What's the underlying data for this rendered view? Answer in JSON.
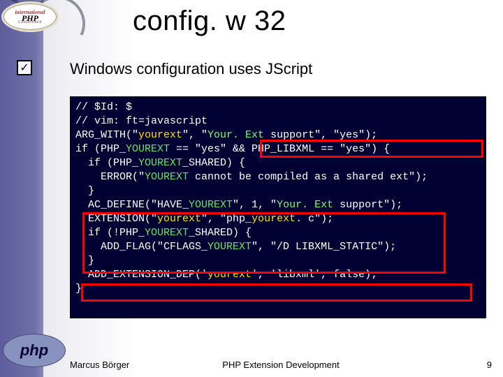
{
  "badge": {
    "line1": "international",
    "line2": "PHP",
    "line3": "conference"
  },
  "title": "config. w 32",
  "subtitle": "Windows configuration uses JScript",
  "checkmark": "✓",
  "code": {
    "l01": "// $Id: $",
    "l02": "// vim: ft=javascript",
    "l03a": "ARG_WITH(\"",
    "l03b": "yourext",
    "l03c": "\", \"",
    "l03d": "Your. Ext",
    "l03e": " support\", \"yes\");",
    "l04a": "if (PHP_",
    "l04b": "YOUREXT",
    "l04c": " == \"yes\"",
    "l04d": " && PHP_LIBXML == \"yes\")",
    "l04e": " {",
    "l05a": "  if (PHP_",
    "l05b": "YOUREXT",
    "l05c": "_SHARED) {",
    "l06a": "    ERROR(\"",
    "l06b": "YOUREXT",
    "l06c": " cannot be compiled as a shared ext\");",
    "l07": "  }",
    "l08a": "  AC_DEFINE(\"HAVE_",
    "l08b": "YOUREXT",
    "l08c": "\", 1, \"",
    "l08d": "Your. Ext",
    "l08e": " support\");",
    "l09a": "  EXTENSION(\"",
    "l09b": "yourext",
    "l09c": "\", \"php_",
    "l09d": "yourext",
    "l09e": ". c\");",
    "l10a": "  if (!PHP_",
    "l10b": "YOUREXT",
    "l10c": "_SHARED) {",
    "l11a": "    ADD_FLAG(\"CFLAGS_",
    "l11b": "YOUREXT",
    "l11c": "\", \"/D LIBXML_STATIC\");",
    "l12": "  }",
    "l13a": "  ADD_EXTENSION_DEP('",
    "l13b": "yourext",
    "l13c": "', 'libxml', false);",
    "l14": "}"
  },
  "footer": {
    "author": "Marcus Börger",
    "title": "PHP Extension Development",
    "page": "9"
  },
  "phplogo": "php"
}
